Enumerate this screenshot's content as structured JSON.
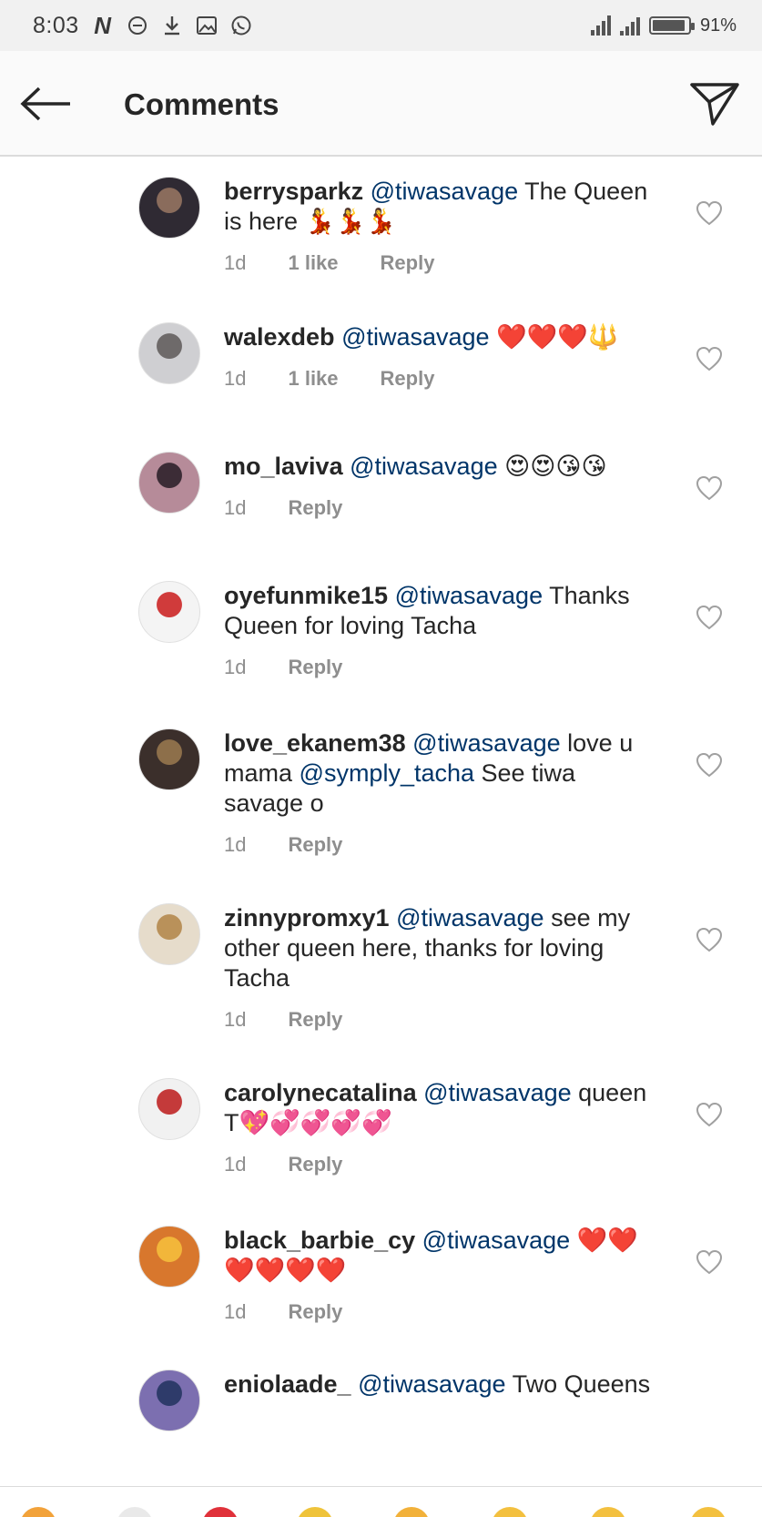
{
  "status_bar": {
    "time": "8:03",
    "battery_text": "91%",
    "battery_level": 0.91,
    "icons": [
      "netflix-n-icon",
      "minus-circle-icon",
      "download-icon",
      "gallery-icon",
      "whatsapp-icon",
      "signal-icon",
      "wifi-bars-icon",
      "battery-icon"
    ]
  },
  "header": {
    "title": "Comments",
    "back_icon": "arrow-left-icon",
    "send_icon": "paper-plane-icon"
  },
  "comments": [
    {
      "user": "berrysparkz",
      "mention": "@tiwasavage",
      "text": "  The Queen is here 💃💃💃",
      "age": "1d",
      "likes": "1 like",
      "reply": "Reply"
    },
    {
      "user": "walexdeb",
      "mention": "@tiwasavage",
      "text": " ❤️❤️❤️🔱",
      "age": "1d",
      "likes": "1 like",
      "reply": "Reply"
    },
    {
      "user": "mo_laviva",
      "mention": "@tiwasavage",
      "text": " 😍😍😘😘",
      "age": "1d",
      "likes": "",
      "reply": "Reply"
    },
    {
      "user": "oyefunmike15",
      "mention": "@tiwasavage",
      "text": " Thanks Queen for loving Tacha",
      "age": "1d",
      "likes": "",
      "reply": "Reply"
    },
    {
      "user": "love_ekanem38",
      "mention": "@tiwasavage",
      "text": " love u mama ",
      "mention2": "@symply_tacha",
      "text2": " See tiwa savage o",
      "age": "1d",
      "likes": "",
      "reply": "Reply"
    },
    {
      "user": "zinnypromxy1",
      "mention": "@tiwasavage",
      "text": " see my other queen here, thanks for loving Tacha",
      "age": "1d",
      "likes": "",
      "reply": "Reply"
    },
    {
      "user": "carolynecatalina",
      "mention": "@tiwasavage",
      "text": " queen T💖💞💞💞💞",
      "age": "1d",
      "likes": "",
      "reply": "Reply"
    },
    {
      "user": "black_barbie_cy",
      "mention": "@tiwasavage",
      "text": " ❤️❤️❤️❤️❤️❤️",
      "age": "1d",
      "likes": "",
      "reply": "Reply"
    },
    {
      "user": "eniolaade_",
      "mention": "@tiwasavage",
      "text": " Two Queens",
      "age": "",
      "likes": "",
      "reply": ""
    }
  ],
  "colors": {
    "mention": "#003569",
    "meta": "#8e8e8e",
    "header_bg": "#fafafa",
    "status_bg": "#f1f1f1"
  }
}
